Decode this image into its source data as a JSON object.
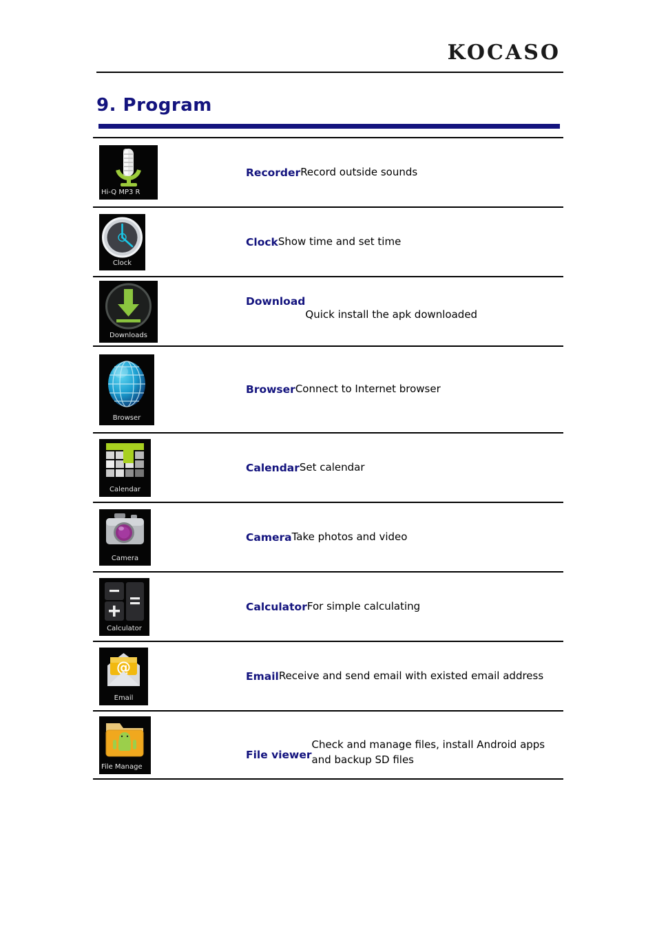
{
  "header": {
    "brand": "KOCASO"
  },
  "title": "9. Program",
  "table": {
    "rows": [
      {
        "icon_name": "recorder-icon",
        "icon_caption": "Hi-Q MP3 R",
        "name": "Recorder",
        "description": "Record outside sounds"
      },
      {
        "icon_name": "clock-icon",
        "icon_caption": "Clock",
        "name": "Clock",
        "description": "Show time and set time"
      },
      {
        "icon_name": "download-icon",
        "icon_caption": "Downloads",
        "name": "Download",
        "description": "Quick install the apk downloaded"
      },
      {
        "icon_name": "browser-icon",
        "icon_caption": "Browser",
        "name": "Browser",
        "description": "Connect to Internet browser"
      },
      {
        "icon_name": "calendar-icon",
        "icon_caption": "Calendar",
        "name": "Calendar",
        "description": "Set calendar"
      },
      {
        "icon_name": "camera-icon",
        "icon_caption": "Camera",
        "name": "Camera",
        "description": "Take photos and video"
      },
      {
        "icon_name": "calculator-icon",
        "icon_caption": "Calculator",
        "name": "Calculator",
        "description": "For simple calculating"
      },
      {
        "icon_name": "email-icon",
        "icon_caption": "Email",
        "name": "Email",
        "description": "Receive and send email with existed email address"
      },
      {
        "icon_name": "file-manager-icon",
        "icon_caption": "File Manage",
        "name": "File viewer",
        "description": "Check and manage files, install Android apps and backup SD files"
      }
    ]
  },
  "colors": {
    "title": "#13137e",
    "name": "#13137e",
    "text": "#000000",
    "rule": "#000000",
    "tile_bg": "#050505"
  }
}
